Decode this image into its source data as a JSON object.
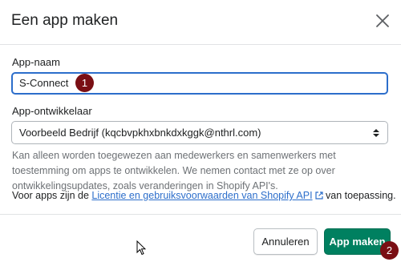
{
  "dialog": {
    "title": "Een app maken",
    "close_icon": "close-icon"
  },
  "form": {
    "app_name_label": "App-naam",
    "app_name_value": "S-Connect",
    "developer_label": "App-ontwikkelaar",
    "developer_value": "Voorbeeld Bedrijf (kqcbvpkhxbnkdxkggk@nthrl.com)",
    "help_text": "Kan alleen worden toegewezen aan medewerkers en samenwerkers met toestemming om apps te ontwikkelen. We nemen contact met ze op over ontwikkelingsupdates, zoals veranderingen in Shopify API's.",
    "terms_prefix": "Voor apps zijn de ",
    "terms_link": "Licentie en gebruiksvoorwaarden van Shopify API",
    "terms_suffix": " van toepassing."
  },
  "footer": {
    "cancel_label": "Annuleren",
    "primary_label": "App maken"
  },
  "annotations": {
    "step1": "1",
    "step2": "2"
  },
  "colors": {
    "primary": "#008060",
    "focus": "#2c6ecb",
    "link": "#2c6ecb",
    "badge": "#7a0f14"
  }
}
